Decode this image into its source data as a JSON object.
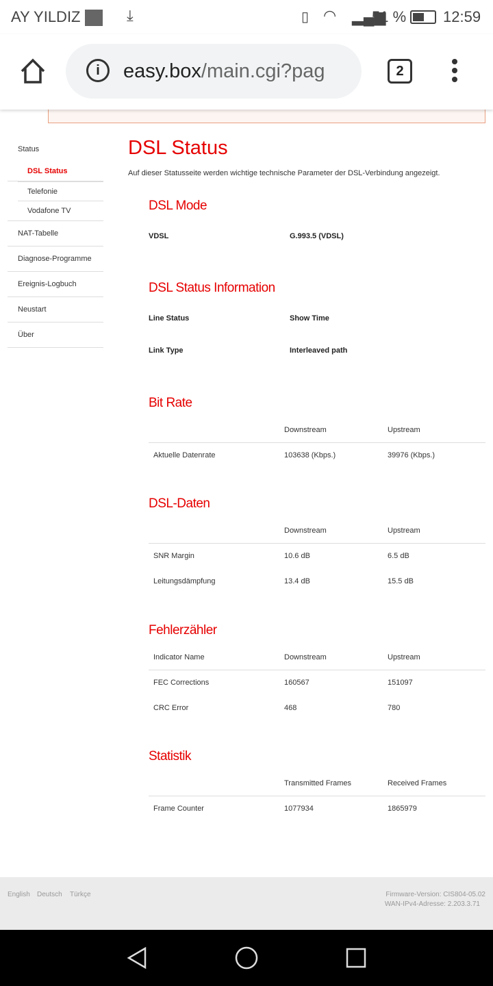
{
  "status_bar": {
    "carrier": "AY YILDIZ",
    "battery": "51 %",
    "time": "12:59"
  },
  "browser": {
    "url_host": "easy.box",
    "url_path": "/main.cgi?pag",
    "tab_count": "2"
  },
  "sidebar": {
    "items": [
      {
        "label": "Status"
      },
      {
        "label": "DSL Status",
        "active": true
      },
      {
        "label": "Telefonie"
      },
      {
        "label": "Vodafone TV"
      },
      {
        "label": "NAT-Tabelle"
      },
      {
        "label": "Diagnose-Programme"
      },
      {
        "label": "Ereignis-Logbuch"
      },
      {
        "label": "Neustart"
      },
      {
        "label": "Über"
      }
    ]
  },
  "page": {
    "title": "DSL Status",
    "description": "Auf dieser Statusseite werden wichtige technische Parameter der DSL-Verbindung angezeigt.",
    "dsl_mode": {
      "title": "DSL Mode",
      "label": "VDSL",
      "value": "G.993.5 (VDSL)"
    },
    "status_info": {
      "title": "DSL Status Information",
      "rows": [
        {
          "label": "Line Status",
          "value": "Show Time"
        },
        {
          "label": "Link Type",
          "value": "Interleaved path"
        }
      ]
    },
    "bit_rate": {
      "title": "Bit Rate",
      "headers": [
        "",
        "Downstream",
        "Upstream"
      ],
      "rows": [
        [
          "Aktuelle Datenrate",
          "103638 (Kbps.)",
          "39976 (Kbps.)"
        ]
      ]
    },
    "dsl_daten": {
      "title": "DSL-Daten",
      "headers": [
        "",
        "Downstream",
        "Upstream"
      ],
      "rows": [
        [
          "SNR Margin",
          "10.6 dB",
          "6.5 dB"
        ],
        [
          "Leitungsdämpfung",
          "13.4 dB",
          "15.5 dB"
        ]
      ]
    },
    "fehler": {
      "title": "Fehlerzähler",
      "headers": [
        "Indicator Name",
        "Downstream",
        "Upstream"
      ],
      "rows": [
        [
          "FEC Corrections",
          "160567",
          "151097"
        ],
        [
          "CRC Error",
          "468",
          "780"
        ]
      ]
    },
    "statistik": {
      "title": "Statistik",
      "headers": [
        "",
        "Transmitted Frames",
        "Received Frames"
      ],
      "rows": [
        [
          "Frame Counter",
          "1077934",
          "1865979"
        ]
      ]
    }
  },
  "footer": {
    "languages": [
      "English",
      "Deutsch",
      "Türkçe"
    ],
    "firmware": "Firmware-Version: CIS804-05.02",
    "wan": "WAN-IPv4-Adresse: 2.203.3.71"
  },
  "colors": {
    "accent": "#e60000"
  }
}
